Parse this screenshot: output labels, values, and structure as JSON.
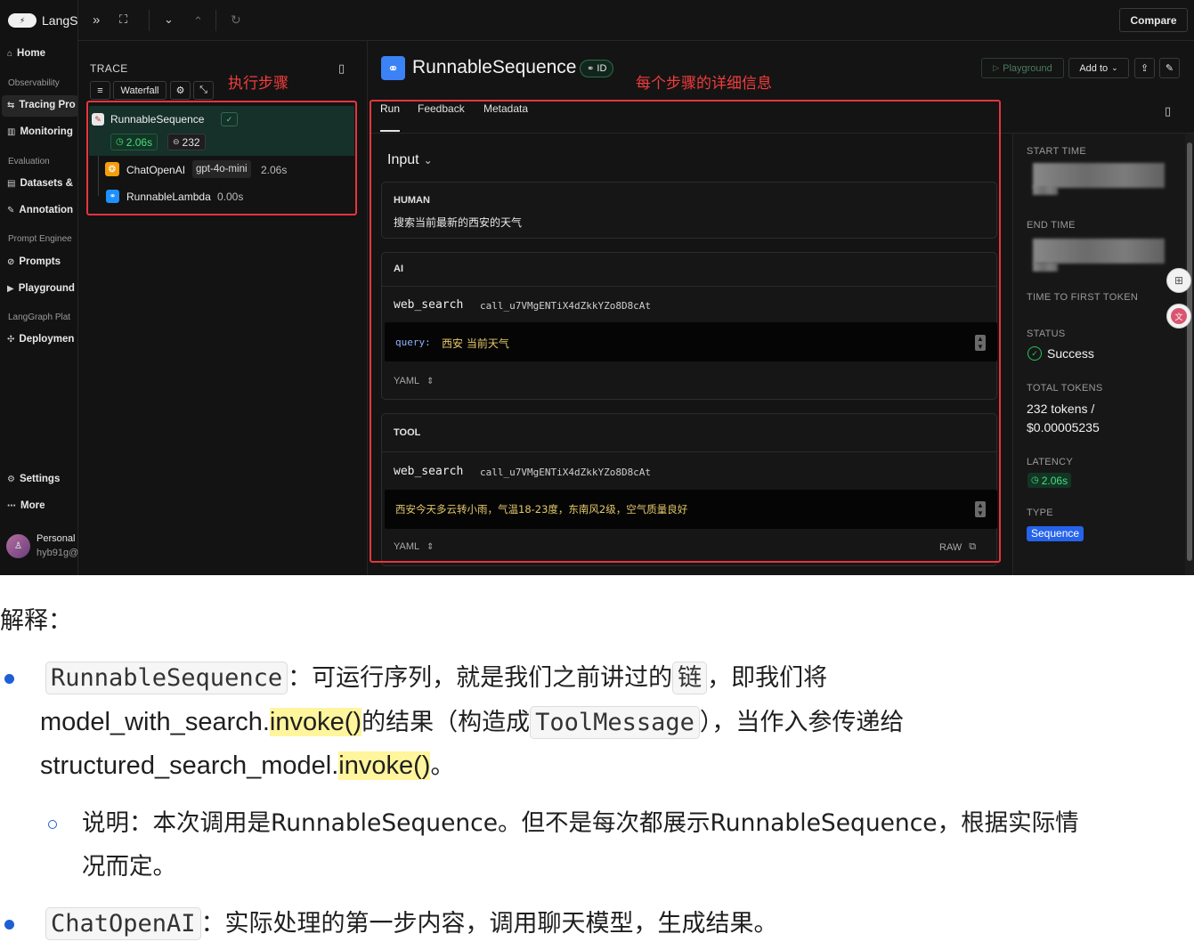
{
  "sidebar": {
    "brand": "LangS",
    "items": [
      {
        "label": "Home",
        "icon": "home-icon"
      },
      {
        "label": "Tracing Pro",
        "icon": "tracing-icon"
      },
      {
        "label": "Monitoring",
        "icon": "monitoring-icon"
      },
      {
        "label": "Datasets &",
        "icon": "datasets-icon"
      },
      {
        "label": "Annotation",
        "icon": "annotation-icon"
      },
      {
        "label": "Prompts",
        "icon": "prompts-icon"
      },
      {
        "label": "Playground",
        "icon": "playground-icon"
      },
      {
        "label": "Deploymen",
        "icon": "deployments-icon"
      },
      {
        "label": "Settings",
        "icon": "gear-icon"
      },
      {
        "label": "More",
        "icon": "more-icon"
      }
    ],
    "sections": [
      "Observability",
      "Evaluation",
      "Prompt Enginee",
      "LangGraph Plat"
    ],
    "profile": {
      "name": "Personal",
      "handle": "hyb91g@"
    }
  },
  "topbar": {
    "compare_label": "Compare"
  },
  "trace": {
    "title": "TRACE",
    "waterfall_label": "Waterfall",
    "root": {
      "name": "RunnableSequence",
      "latency": "2.06s",
      "tokens": "232"
    },
    "children": [
      {
        "name": "ChatOpenAI",
        "model": "gpt-4o-mini",
        "latency": "2.06s"
      },
      {
        "name": "RunnableLambda",
        "latency": "0.00s"
      }
    ]
  },
  "annotations": {
    "steps": "执行步骤",
    "details": "每个步骤的详细信息"
  },
  "run": {
    "title": "RunnableSequence",
    "id_label": "ID",
    "playground_label": "Playground",
    "add_to_label": "Add to",
    "tabs": [
      "Run",
      "Feedback",
      "Metadata"
    ],
    "input_label": "Input",
    "human": {
      "role": "HUMAN",
      "text": "搜索当前最新的西安的天气"
    },
    "ai": {
      "role": "AI",
      "tool_name": "web_search",
      "call_id": "call_u7VMgENTiX4dZkkYZo8D8cAt",
      "query_key": "query:",
      "query_value": "西安 当前天气",
      "format": "YAML"
    },
    "tool": {
      "role": "TOOL",
      "tool_name": "web_search",
      "call_id": "call_u7VMgENTiX4dZkkYZo8D8cAt",
      "result": "西安今天多云转小雨，气温18-23度，东南风2级，空气质量良好",
      "format": "YAML",
      "raw_label": "RAW"
    }
  },
  "meta": {
    "start_time_label": "START TIME",
    "end_time_label": "END TIME",
    "ttft_label": "TIME TO FIRST TOKEN",
    "status_label": "STATUS",
    "status_value": "Success",
    "total_tokens_label": "TOTAL TOKENS",
    "total_tokens_line1": "232 tokens /",
    "total_tokens_line2": "$0.00005235",
    "latency_label": "LATENCY",
    "latency_value": "2.06s",
    "type_label": "TYPE",
    "type_value": "Sequence"
  },
  "explanation": {
    "heading": "解释：",
    "b1_code": "RunnableSequence",
    "b1_t1": "：可运行序列，就是我们之前讲过的",
    "b1_code2": "链",
    "b1_t2": "，即我们将",
    "b1_l2_a": "model_with_search.",
    "b1_l2_hl": "invoke()",
    "b1_l2_b": "的结果（构造成",
    "b1_l2_code": "ToolMessage",
    "b1_l2_c": "），当作入参传递给",
    "b1_l3_a": "structured_search_model.",
    "b1_l3_hl": "invoke()",
    "b1_l3_b": "。",
    "sub1": "说明：本次调用是RunnableSequence。但不是每次都展示RunnableSequence，根据实际情",
    "sub2": "况而定。",
    "b2_code": "ChatOpenAI",
    "b2_t": "：实际处理的第一步内容，调用聊天模型，生成结果。"
  },
  "colors": {
    "accent_blue": "#2563eb",
    "success_green": "#22c55e",
    "annotation_red": "#e5353d",
    "highlight": "#fff59c"
  }
}
